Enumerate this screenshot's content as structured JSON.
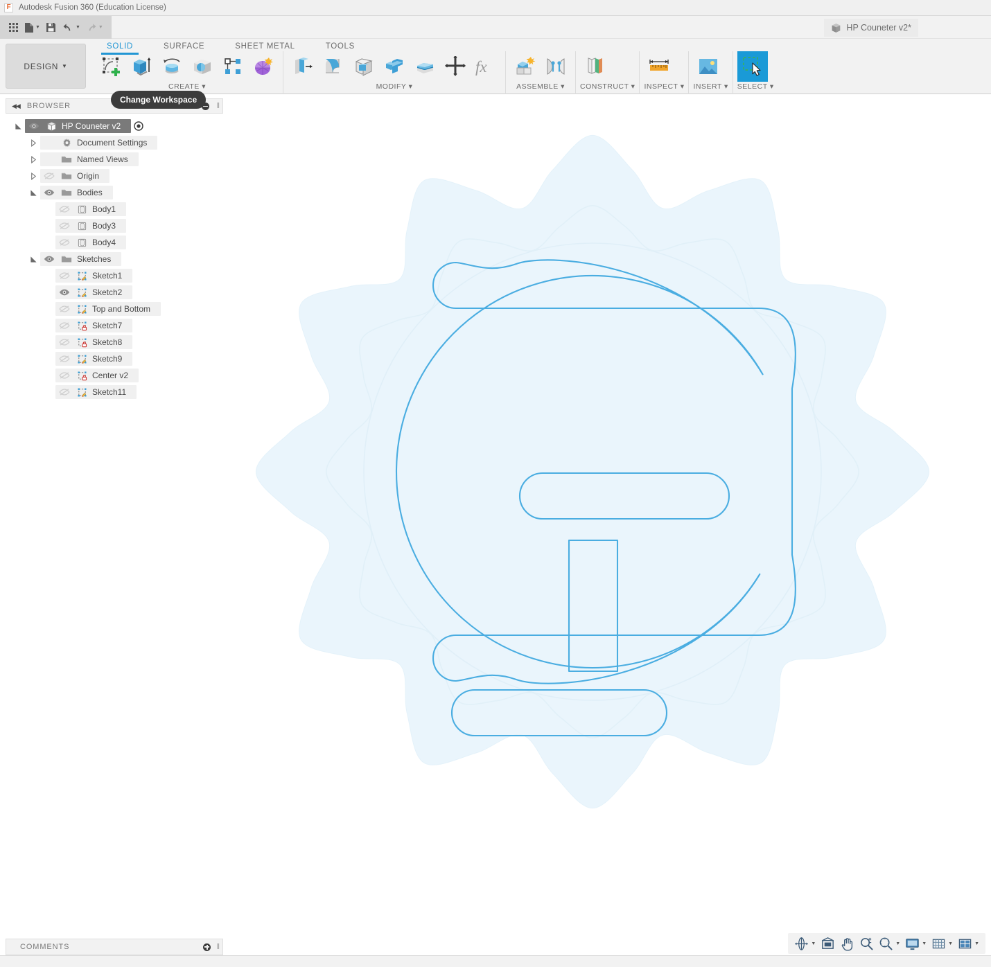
{
  "window": {
    "title": "Autodesk Fusion 360 (Education License)",
    "logo_letter": "F",
    "logo_icon": "fusion-logo-icon"
  },
  "quick_access": {
    "items": [
      {
        "icon": "grid-apps-icon",
        "name": "show-data-panel-button",
        "caret": false,
        "enabled": true
      },
      {
        "icon": "file-new-icon",
        "name": "file-menu-button",
        "caret": true,
        "enabled": true
      },
      {
        "icon": "save-icon",
        "name": "save-button",
        "caret": false,
        "enabled": true
      },
      {
        "icon": "undo-icon",
        "name": "undo-button",
        "caret": true,
        "enabled": true
      },
      {
        "icon": "redo-icon",
        "name": "redo-button",
        "caret": true,
        "enabled": false
      }
    ]
  },
  "document_tab": {
    "label": "HP Couneter v2*",
    "icon": "cube-icon"
  },
  "ribbon": {
    "workspace_button": {
      "label": "DESIGN",
      "caret": "▾"
    },
    "tooltip": "Change Workspace",
    "tabs": [
      {
        "label": "SOLID",
        "active": true
      },
      {
        "label": "SURFACE",
        "active": false
      },
      {
        "label": "SHEET METAL",
        "active": false
      },
      {
        "label": "TOOLS",
        "active": false
      }
    ],
    "groups": [
      {
        "label": "CREATE",
        "caret": "▾",
        "tools": [
          {
            "name": "create-sketch-tool",
            "icon": "sketch-plus-icon",
            "selected": false
          },
          {
            "name": "extrude-tool",
            "icon": "extrude-icon",
            "selected": false
          },
          {
            "name": "revolve-tool",
            "icon": "revolve-icon",
            "selected": false
          },
          {
            "name": "sweep-tool",
            "icon": "sweep-icon",
            "selected": false
          },
          {
            "name": "pattern-tool",
            "icon": "rect-pattern-icon",
            "selected": false
          },
          {
            "name": "form-tool",
            "icon": "form-sculpt-icon",
            "selected": false
          }
        ]
      },
      {
        "label": "MODIFY",
        "caret": "▾",
        "tools": [
          {
            "name": "press-pull-tool",
            "icon": "press-pull-icon",
            "selected": false
          },
          {
            "name": "fillet-tool",
            "icon": "fillet-icon",
            "selected": false
          },
          {
            "name": "shell-tool",
            "icon": "shell-icon",
            "selected": false
          },
          {
            "name": "combine-tool",
            "icon": "combine-icon",
            "selected": false
          },
          {
            "name": "split-face-tool",
            "icon": "split-face-icon",
            "selected": false
          },
          {
            "name": "move-copy-tool",
            "icon": "move-arrows-icon",
            "selected": false
          },
          {
            "name": "parameters-tool",
            "icon": "fx-icon",
            "selected": false
          }
        ]
      },
      {
        "label": "ASSEMBLE",
        "caret": "▾",
        "tools": [
          {
            "name": "new-component-tool",
            "icon": "new-component-icon",
            "selected": false
          },
          {
            "name": "joint-tool",
            "icon": "joint-icon",
            "selected": false
          }
        ]
      },
      {
        "label": "CONSTRUCT",
        "caret": "▾",
        "tools": [
          {
            "name": "construct-plane-tool",
            "icon": "offset-plane-icon",
            "selected": false
          }
        ]
      },
      {
        "label": "INSPECT",
        "caret": "▾",
        "tools": [
          {
            "name": "measure-tool",
            "icon": "measure-ruler-icon",
            "selected": false
          }
        ]
      },
      {
        "label": "INSERT",
        "caret": "▾",
        "tools": [
          {
            "name": "insert-mcmaster-tool",
            "icon": "insert-image-icon",
            "selected": false
          }
        ]
      },
      {
        "label": "SELECT",
        "caret": "▾",
        "tools": [
          {
            "name": "select-tool",
            "icon": "select-cursor-icon",
            "selected": true
          }
        ]
      }
    ]
  },
  "browser": {
    "title": "BROWSER",
    "collapse_icon": "double-chevron-left-icon",
    "minimize_icon": "minimize-circle-icon",
    "grip_icon": "resize-grip-icon",
    "nodes": [
      {
        "label": "HP Couneter v2",
        "indent": 0,
        "expander": "down",
        "eye": "visible",
        "icon": "component-cube-icon",
        "selected": true,
        "target": true,
        "name": "tree-node-hp-couneter-v2"
      },
      {
        "label": "Document Settings",
        "indent": 1,
        "expander": "right",
        "eye": "none",
        "icon": "gear-icon",
        "selected": false,
        "target": false,
        "name": "tree-node-document-settings"
      },
      {
        "label": "Named Views",
        "indent": 1,
        "expander": "right",
        "eye": "none",
        "icon": "folder-icon",
        "selected": false,
        "target": false,
        "name": "tree-node-named-views"
      },
      {
        "label": "Origin",
        "indent": 1,
        "expander": "right",
        "eye": "hidden",
        "icon": "folder-icon",
        "selected": false,
        "target": false,
        "name": "tree-node-origin"
      },
      {
        "label": "Bodies",
        "indent": 1,
        "expander": "down",
        "eye": "visible",
        "icon": "folder-icon",
        "selected": false,
        "target": false,
        "name": "tree-node-bodies"
      },
      {
        "label": "Body1",
        "indent": 2,
        "expander": "none",
        "eye": "hidden",
        "icon": "body-icon",
        "selected": false,
        "target": false,
        "name": "tree-node-body1"
      },
      {
        "label": "Body3",
        "indent": 2,
        "expander": "none",
        "eye": "hidden",
        "icon": "body-icon",
        "selected": false,
        "target": false,
        "name": "tree-node-body3"
      },
      {
        "label": "Body4",
        "indent": 2,
        "expander": "none",
        "eye": "hidden",
        "icon": "body-icon",
        "selected": false,
        "target": false,
        "name": "tree-node-body4"
      },
      {
        "label": "Sketches",
        "indent": 1,
        "expander": "down",
        "eye": "visible",
        "icon": "folder-icon",
        "selected": false,
        "target": false,
        "name": "tree-node-sketches"
      },
      {
        "label": "Sketch1",
        "indent": 2,
        "expander": "none",
        "eye": "hidden",
        "icon": "sketch-icon",
        "selected": false,
        "target": false,
        "name": "tree-node-sketch1"
      },
      {
        "label": "Sketch2",
        "indent": 2,
        "expander": "none",
        "eye": "visible",
        "icon": "sketch-icon",
        "selected": false,
        "target": false,
        "name": "tree-node-sketch2"
      },
      {
        "label": "Top and Bottom",
        "indent": 2,
        "expander": "none",
        "eye": "hidden",
        "icon": "sketch-icon",
        "selected": false,
        "target": false,
        "name": "tree-node-top-and-bottom"
      },
      {
        "label": "Sketch7",
        "indent": 2,
        "expander": "none",
        "eye": "hidden",
        "icon": "sketch-locked-icon",
        "selected": false,
        "target": false,
        "name": "tree-node-sketch7"
      },
      {
        "label": "Sketch8",
        "indent": 2,
        "expander": "none",
        "eye": "hidden",
        "icon": "sketch-locked-icon",
        "selected": false,
        "target": false,
        "name": "tree-node-sketch8"
      },
      {
        "label": "Sketch9",
        "indent": 2,
        "expander": "none",
        "eye": "hidden",
        "icon": "sketch-icon",
        "selected": false,
        "target": false,
        "name": "tree-node-sketch9"
      },
      {
        "label": "Center v2",
        "indent": 2,
        "expander": "none",
        "eye": "hidden",
        "icon": "sketch-locked-icon",
        "selected": false,
        "target": false,
        "name": "tree-node-center-v2"
      },
      {
        "label": "Sketch11",
        "indent": 2,
        "expander": "none",
        "eye": "hidden",
        "icon": "sketch-icon",
        "selected": false,
        "target": false,
        "name": "tree-node-sketch11"
      }
    ]
  },
  "canvas": {
    "background": "#ffffff",
    "body_fill": "#eaf5fc",
    "body_edge": "#e0f0f9",
    "sketch_line": "#4aade1",
    "description": "Gear-shaped extruded body with 12 teeth and a visible sketch profile of a stylised G with a central slot"
  },
  "comments": {
    "title": "COMMENTS",
    "add_icon": "add-comment-icon",
    "grip_icon": "resize-grip-icon"
  },
  "navbar": {
    "items": [
      {
        "name": "orbit-button",
        "icon": "orbit-icon",
        "caret": true
      },
      {
        "name": "look-at-button",
        "icon": "look-at-icon",
        "caret": false
      },
      {
        "name": "pan-button",
        "icon": "pan-hand-icon",
        "caret": false
      },
      {
        "name": "zoom-button",
        "icon": "zoom-icon",
        "caret": false
      },
      {
        "name": "fit-button",
        "icon": "zoom-fit-icon",
        "caret": true
      },
      {
        "name": "display-settings-button",
        "icon": "monitor-icon",
        "caret": true
      },
      {
        "name": "grid-snaps-button",
        "icon": "grid-icon",
        "caret": true
      },
      {
        "name": "viewports-button",
        "icon": "viewports-icon",
        "caret": true
      }
    ]
  },
  "colors": {
    "accent": "#2196d4",
    "select_highlight": "#1a9ad7",
    "sketch_blue": "#4aade1",
    "body_fill": "#eaf5fc",
    "chrome_gray": "#f2f2f2",
    "tooltip_bg": "#3c3c3c"
  }
}
